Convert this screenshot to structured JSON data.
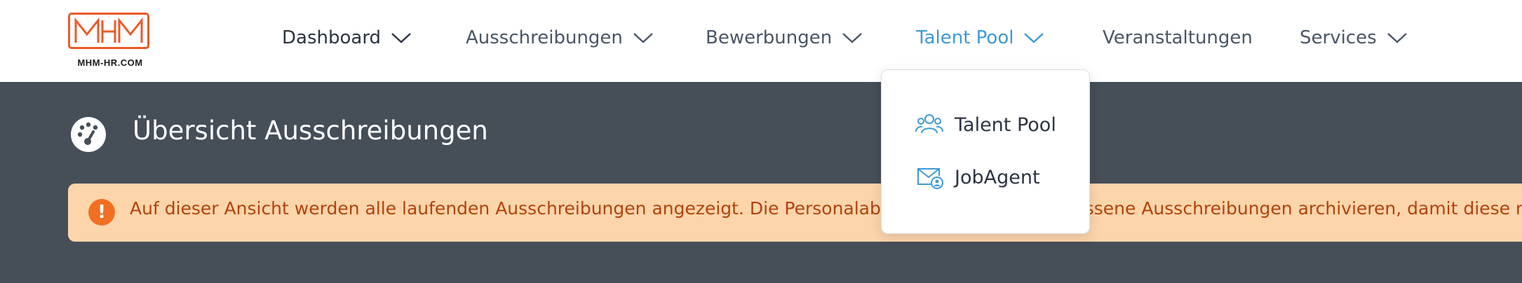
{
  "logo": {
    "mark": "MHM",
    "text": "MHM-HR.COM"
  },
  "nav": {
    "items": [
      {
        "label": "Dashboard",
        "has_dropdown": true
      },
      {
        "label": "Ausschreibungen",
        "has_dropdown": true
      },
      {
        "label": "Bewerbungen",
        "has_dropdown": true
      },
      {
        "label": "Talent Pool",
        "has_dropdown": true,
        "active": true
      },
      {
        "label": "Veranstaltungen",
        "has_dropdown": false
      },
      {
        "label": "Services",
        "has_dropdown": true
      }
    ]
  },
  "dropdown": {
    "items": [
      {
        "label": "Talent Pool",
        "icon": "users-icon"
      },
      {
        "label": "JobAgent",
        "icon": "envelope-user-icon"
      }
    ]
  },
  "page": {
    "title": "Übersicht Ausschreibungen",
    "icon": "dashboard-gauge-icon"
  },
  "alert": {
    "text": "Auf dieser Ansicht werden alle laufenden Ausschreibungen angezeigt. Die Personalabteilung kann abgeschlossene Ausschreibungen archivieren, damit diese n",
    "icon": "exclamation-icon"
  },
  "colors": {
    "brand": "#ec5a27",
    "active": "#3d9ad6",
    "hero_bg": "#464e58",
    "alert_bg": "#fdd5ab",
    "alert_text": "#b2430c"
  }
}
